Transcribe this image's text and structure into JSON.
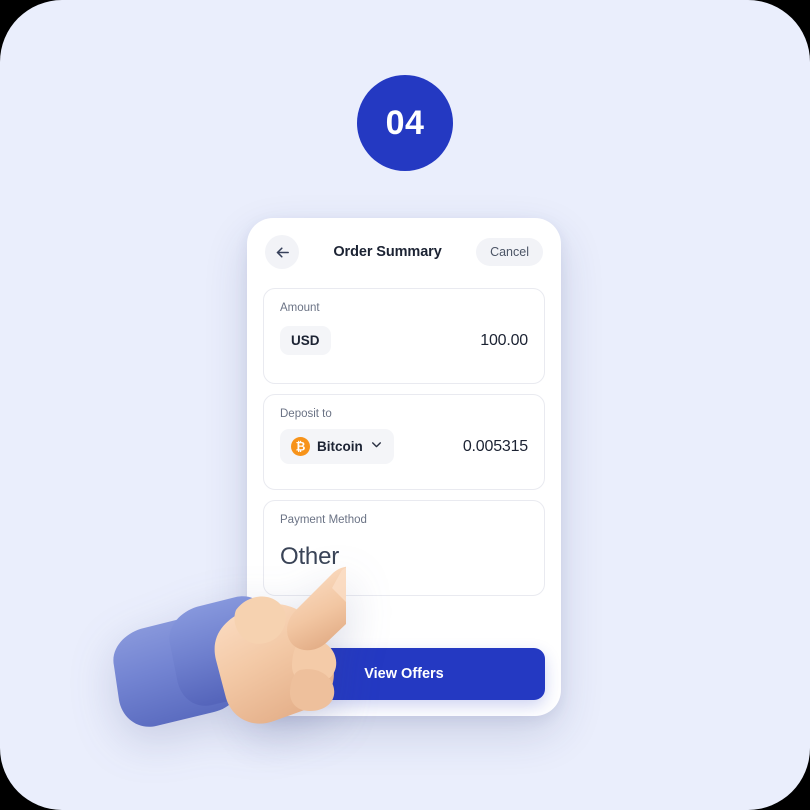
{
  "theme": {
    "page_background": "#eaeefc",
    "accent_blue": "#2439c2",
    "card_background": "#ffffff",
    "card_border": "#e9eaf0",
    "pill_background": "#f4f5f8",
    "bitcoin_orange": "#f7931a",
    "label_text": "#6b7385",
    "value_text": "#1c2333",
    "sleeve_blue": "#7a8ad6",
    "skin_tone": "#f0c3a0"
  },
  "step_badge": {
    "number": "04"
  },
  "app": {
    "header": {
      "back_icon": "arrow-left-icon",
      "title": "Order Summary",
      "cancel_label": "Cancel"
    },
    "sections": [
      {
        "key": "amount",
        "label": "Amount",
        "pill_text": "USD",
        "value": "100.00",
        "has_icon": false,
        "has_chevron": false
      },
      {
        "key": "deposit",
        "label": "Deposit to",
        "pill_text": "Bitcoin",
        "value": "0.005315",
        "has_icon": true,
        "icon": "bitcoin-icon",
        "icon_glyph": "₿",
        "has_chevron": true,
        "chevron": "chevron-down-icon"
      }
    ],
    "payment_method": {
      "label": "Payment Method",
      "value": "Other"
    },
    "cta": {
      "label": "View Offers"
    }
  },
  "illustration": {
    "name": "pointing-hand-3d",
    "description": "3d hand with index finger pointing at the payment method card"
  }
}
